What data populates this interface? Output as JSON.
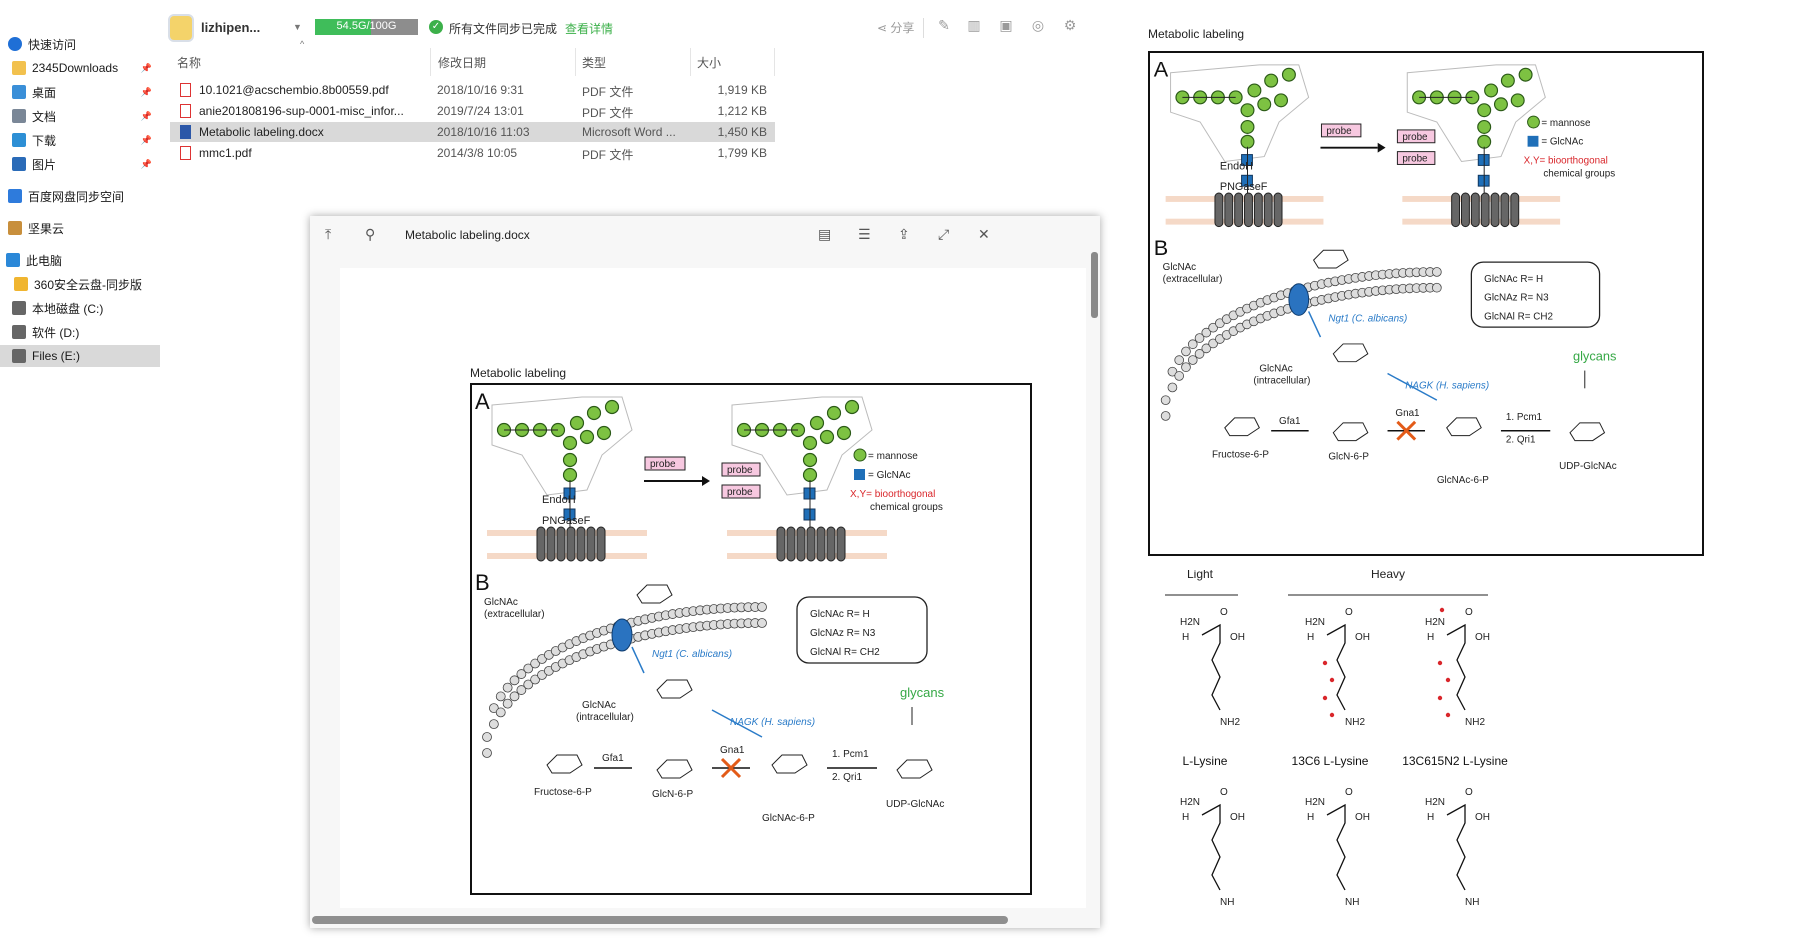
{
  "sidebar": {
    "items": [
      {
        "label": "快速访问",
        "icon": "star-icon",
        "color": "#1f6fd6"
      },
      {
        "label": "2345Downloads",
        "icon": "folder-icon",
        "color": "#f2c14e",
        "pinned": true
      },
      {
        "label": "桌面",
        "icon": "desktop-icon",
        "color": "#3a8fd8",
        "pinned": true
      },
      {
        "label": "文档",
        "icon": "document-icon",
        "color": "#7a8797",
        "pinned": true
      },
      {
        "label": "下载",
        "icon": "download-icon",
        "color": "#2d8fd5",
        "pinned": true
      },
      {
        "label": "图片",
        "icon": "picture-icon",
        "color": "#2a6bb8",
        "pinned": true
      },
      {
        "label": "百度网盘同步空间",
        "icon": "cloud-sync-icon",
        "color": "#2e7bdc"
      },
      {
        "label": "坚果云",
        "icon": "nut-cloud-icon",
        "color": "#c88f3c"
      },
      {
        "label": "此电脑",
        "icon": "computer-icon",
        "color": "#2b88d8"
      },
      {
        "label": "360安全云盘-同步版",
        "icon": "drive-icon",
        "color": "#f0b530"
      },
      {
        "label": "本地磁盘 (C:)",
        "icon": "disk-icon",
        "color": "#666"
      },
      {
        "label": "软件 (D:)",
        "icon": "disk-icon",
        "color": "#666"
      },
      {
        "label": "Files (E:)",
        "icon": "disk-icon",
        "color": "#666",
        "selected": true
      }
    ]
  },
  "toolbar": {
    "user_name": "lizhipen...",
    "quota_text": "54.5G/100G",
    "quota_fraction": 0.545,
    "sync_status": "所有文件同步已完成",
    "sync_link": "查看详情",
    "share_label": "分享"
  },
  "file_list": {
    "headers": {
      "name": "名称",
      "date": "修改日期",
      "type": "类型",
      "size": "大小"
    },
    "rows": [
      {
        "name": "10.1021@acschembio.8b00559.pdf",
        "date": "2018/10/16 9:31",
        "type": "PDF 文件",
        "size": "1,919 KB",
        "icon": "pdf-icon"
      },
      {
        "name": "anie201808196-sup-0001-misc_infor...",
        "date": "2019/7/24 13:01",
        "type": "PDF 文件",
        "size": "1,212 KB",
        "icon": "pdf-icon"
      },
      {
        "name": "Metabolic labeling.docx",
        "date": "2018/10/16 11:03",
        "type": "Microsoft Word ...",
        "size": "1,450 KB",
        "icon": "word-icon",
        "selected": true
      },
      {
        "name": "mmc1.pdf",
        "date": "2014/3/8 10:05",
        "type": "PDF 文件",
        "size": "1,799 KB",
        "icon": "pdf-icon"
      }
    ]
  },
  "preview": {
    "title": "Metabolic labeling.docx",
    "doc_heading": "Metabolic labeling"
  },
  "figure": {
    "heading": "Metabolic labeling",
    "panel_a": "A",
    "panel_b": "B",
    "endoh": "EndoH",
    "pngasef": "PNGaseF",
    "probe": "probe",
    "legend_mannose": "= mannose",
    "legend_glcnac": "= GlcNAc",
    "legend_xy": "X,Y= bioorthogonal",
    "legend_xy2": "chemical groups",
    "glcnac_ext": "GlcNAc",
    "glcnac_ext2": "(extracellular)",
    "glcnac_int": "GlcNAc",
    "glcnac_int2": "(intracellular)",
    "ngt1": "Ngt1 (C. albicans)",
    "nagk": "NAGK (H. sapiens)",
    "r_table": [
      "GlcNAc  R= H",
      "GlcNAz  R= N3",
      "GlcNAl  R= CH2"
    ],
    "glycans": "glycans",
    "fructose": "Fructose-6-P",
    "gfa1": "Gfa1",
    "glcn6p": "GlcN-6-P",
    "gna1": "Gna1",
    "glcnac6p": "GlcNAc-6-P",
    "pcm1": "1. Pcm1",
    "qri1": "2. Qri1",
    "udp": "UDP-GlcNAc"
  },
  "lysine": {
    "light_header": "Light",
    "heavy_header": "Heavy",
    "labels": [
      "L-Lysine",
      "13C6 L-Lysine",
      "13C615N2 L-Lysine"
    ],
    "h2n": "H2N",
    "h": "H",
    "oh": "OH",
    "o": "O",
    "nh2": "NH2",
    "nh": "NH"
  },
  "colors": {
    "green_glycan": "#7dc242",
    "blue_glcnac": "#1f6fb8",
    "probe_pink": "#f7c8e0",
    "red": "#d9262b",
    "glycans_green": "#35a845",
    "arrow_blue": "#2a7bc8"
  }
}
